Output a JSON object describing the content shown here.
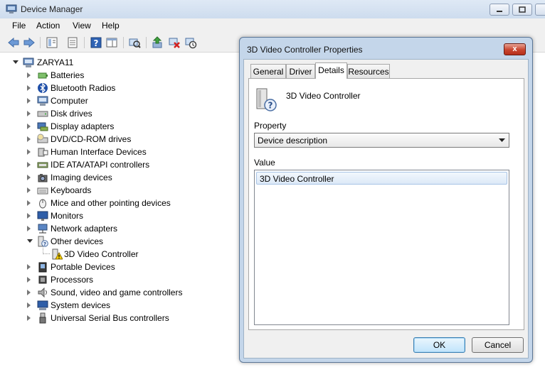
{
  "window": {
    "title": "Device Manager"
  },
  "menu": [
    "File",
    "Action",
    "View",
    "Help"
  ],
  "tree": {
    "root": "ZARYA11",
    "items": [
      {
        "label": "Batteries",
        "icon": "battery-icon",
        "state": "collapsed"
      },
      {
        "label": "Bluetooth Radios",
        "icon": "bluetooth-icon",
        "state": "collapsed"
      },
      {
        "label": "Computer",
        "icon": "computer-icon",
        "state": "collapsed"
      },
      {
        "label": "Disk drives",
        "icon": "disk-drive-icon",
        "state": "collapsed"
      },
      {
        "label": "Display adapters",
        "icon": "display-adapter-icon",
        "state": "collapsed"
      },
      {
        "label": "DVD/CD-ROM drives",
        "icon": "dvd-drive-icon",
        "state": "collapsed"
      },
      {
        "label": "Human Interface Devices",
        "icon": "hid-icon",
        "state": "collapsed"
      },
      {
        "label": "IDE ATA/ATAPI controllers",
        "icon": "ide-controller-icon",
        "state": "collapsed"
      },
      {
        "label": "Imaging devices",
        "icon": "camera-icon",
        "state": "collapsed"
      },
      {
        "label": "Keyboards",
        "icon": "keyboard-icon",
        "state": "collapsed"
      },
      {
        "label": "Mice and other pointing devices",
        "icon": "mouse-icon",
        "state": "collapsed"
      },
      {
        "label": "Monitors",
        "icon": "monitor-icon",
        "state": "collapsed"
      },
      {
        "label": "Network adapters",
        "icon": "network-adapter-icon",
        "state": "collapsed"
      },
      {
        "label": "Other devices",
        "icon": "unknown-device-icon",
        "state": "expanded"
      },
      {
        "label": "3D Video Controller",
        "icon": "warning-device-icon",
        "state": "child"
      },
      {
        "label": "Portable Devices",
        "icon": "portable-device-icon",
        "state": "collapsed"
      },
      {
        "label": "Processors",
        "icon": "processor-icon",
        "state": "collapsed"
      },
      {
        "label": "Sound, video and game controllers",
        "icon": "speaker-icon",
        "state": "collapsed"
      },
      {
        "label": "System devices",
        "icon": "system-device-icon",
        "state": "collapsed"
      },
      {
        "label": "Universal Serial Bus controllers",
        "icon": "usb-icon",
        "state": "collapsed"
      }
    ]
  },
  "dialog": {
    "title": "3D Video Controller Properties",
    "close_label": "x",
    "tabs": [
      "General",
      "Driver",
      "Details",
      "Resources"
    ],
    "active_tab": "Details",
    "device_name": "3D Video Controller",
    "property_label": "Property",
    "property_value": "Device description",
    "value_label": "Value",
    "values": [
      "3D Video Controller"
    ],
    "ok_label": "OK",
    "cancel_label": "Cancel"
  },
  "colors": {
    "title_bar": "#cddcee",
    "dialog_frame": "#c4d6ea",
    "selection": "#dce9f7",
    "close_button": "#c9452f"
  }
}
